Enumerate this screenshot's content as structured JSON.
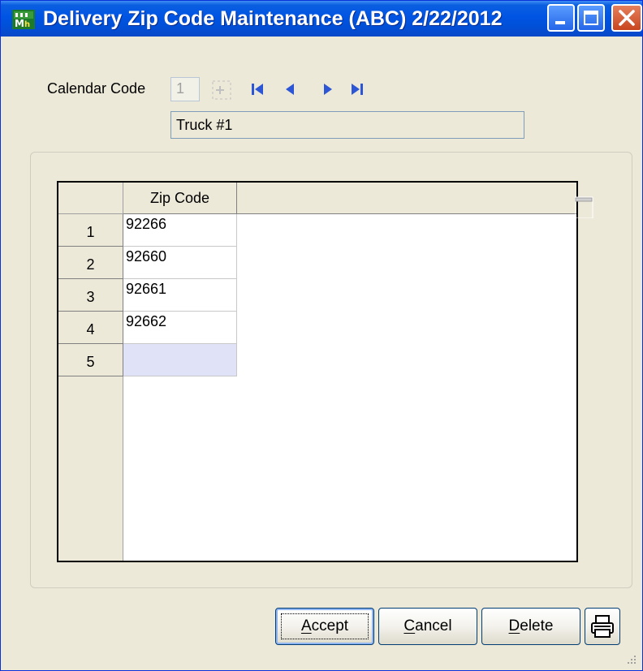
{
  "window": {
    "title": "Delivery Zip Code Maintenance (ABC) 2/22/2012",
    "app_icon": "mas90-app-icon",
    "controls": [
      "minimize-icon",
      "maximize-icon",
      "close-icon"
    ]
  },
  "form": {
    "calendar_code_label": "Calendar Code",
    "calendar_code_value": "1",
    "description_value": "Truck #1",
    "nav_icons": [
      "lookup-icon",
      "first-record-icon",
      "previous-record-icon",
      "next-record-icon",
      "last-record-icon"
    ]
  },
  "grid": {
    "column_header": "Zip Code",
    "rows": [
      {
        "num": "1",
        "zip": "92266"
      },
      {
        "num": "2",
        "zip": "92660"
      },
      {
        "num": "3",
        "zip": "92661"
      },
      {
        "num": "4",
        "zip": "92662"
      },
      {
        "num": "5",
        "zip": ""
      }
    ]
  },
  "buttons": {
    "accept_mnemonic": "A",
    "accept_rest": "ccept",
    "cancel_mnemonic": "C",
    "cancel_rest": "ancel",
    "delete_mnemonic": "D",
    "delete_rest": "elete",
    "print_icon": "printer-icon"
  },
  "colors": {
    "titlebar": "#0054e3",
    "window_face": "#ece9d8",
    "active_cell": "#e0e2f8"
  }
}
